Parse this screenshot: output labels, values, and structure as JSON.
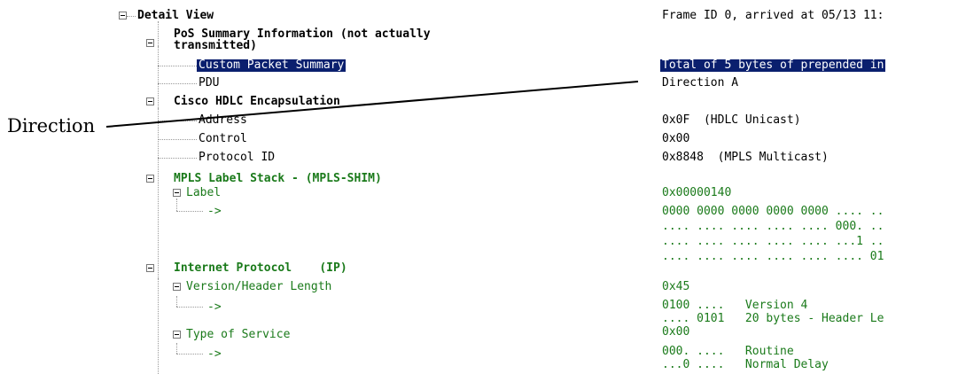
{
  "tree": {
    "root": "Detail View",
    "pos_summary_line1": "PoS Summary Information (not actually",
    "pos_summary_line2": "transmitted)",
    "custom_packet_summary": "Custom Packet Summary",
    "pdu": "PDU",
    "cisco_hdlc": "Cisco HDLC Encapsulation",
    "address": "Address",
    "control": "Control",
    "protocol_id": "Protocol ID",
    "mpls": "MPLS Label Stack - (MPLS-SHIM)",
    "label": "Label",
    "label_arrow": "->",
    "ip": "Internet Protocol    (IP)",
    "version_header": "Version/Header Length",
    "version_arrow": "->",
    "tos": "Type of Service",
    "tos_arrow": "->"
  },
  "values": {
    "frame": "Frame ID 0, arrived at 05/13 11:",
    "summary": "Total of 5 bytes of prepended in",
    "direction": "Direction A",
    "address": "0x0F  (HDLC Unicast)",
    "control": "0x00",
    "protocol_id": "0x8848  (MPLS Multicast)",
    "label": "0x00000140",
    "bits1": "0000 0000 0000 0000 0000 .... ..",
    "bits2": ".... .... .... .... .... 000. ..",
    "bits3": ".... .... .... .... .... ...1 ..",
    "bits4": ".... .... .... .... .... .... 01",
    "version_header": "0x45",
    "version_bits": "0100 ....   Version 4",
    "header_len_bits": ".... 0101   20 bytes - Header Le",
    "tos": "0x00",
    "tos_bits1": "000. ....   Routine",
    "tos_bits2": "...0 ....   Normal Delay"
  },
  "callout": {
    "label": "Direction"
  }
}
